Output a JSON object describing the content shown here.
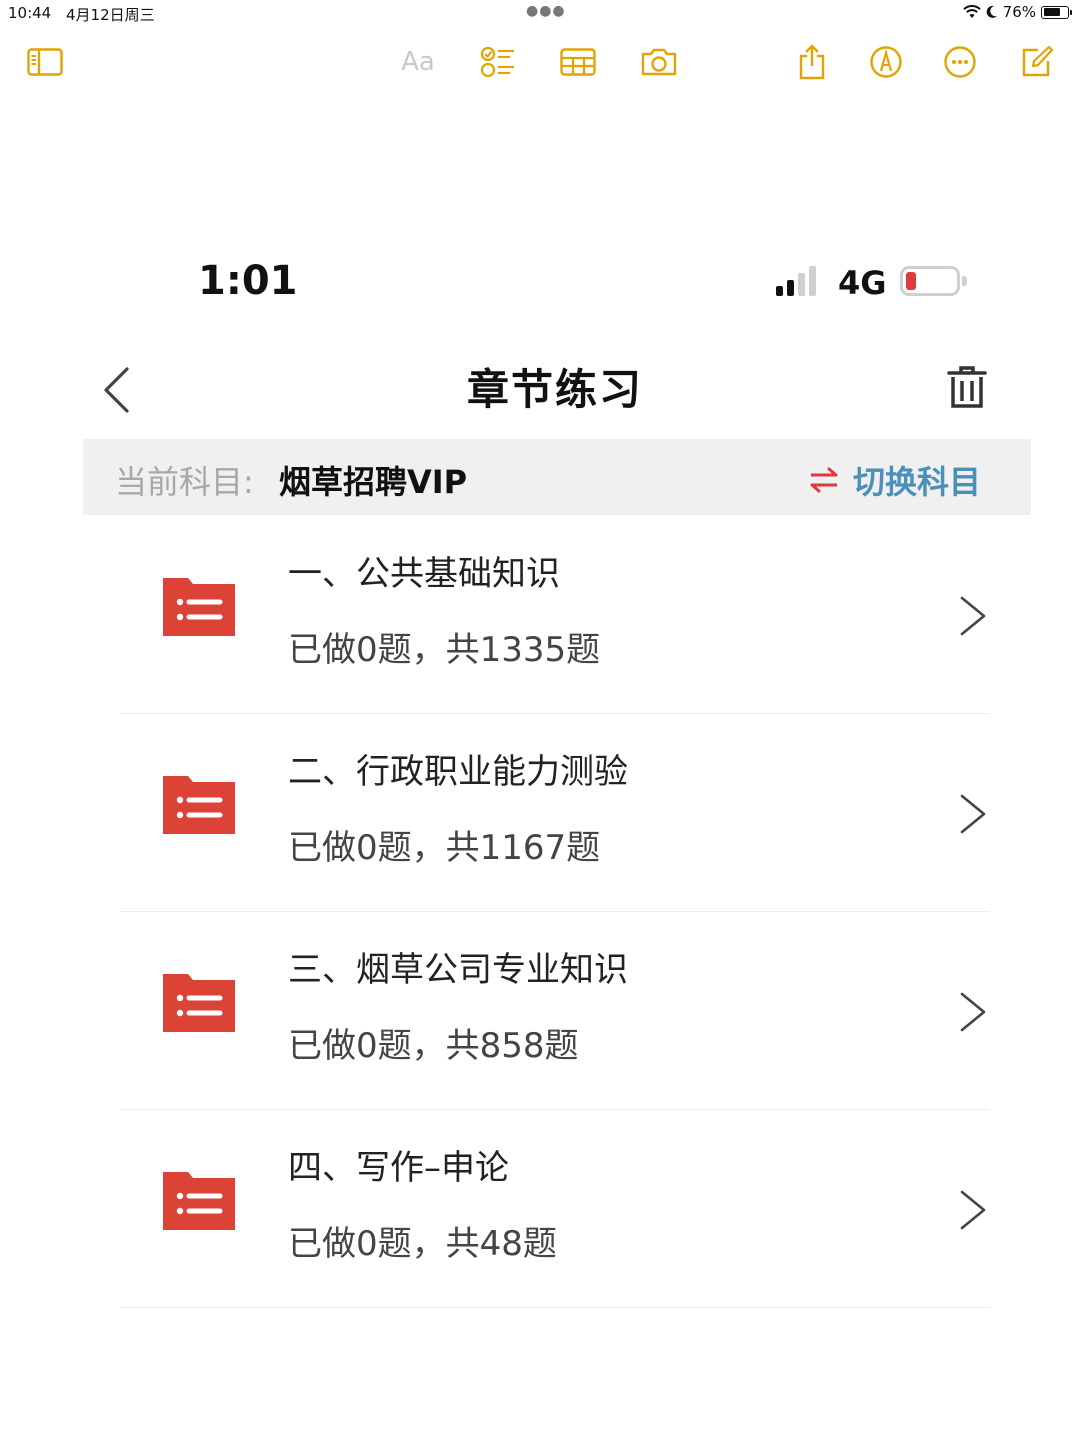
{
  "ipad_status": {
    "time": "10:44",
    "date": "4月12日周三",
    "battery_percent": "76%",
    "battery_level": 0.76
  },
  "toolbar": {
    "format_label": "Aa",
    "accent_color": "#e2a400",
    "icons": [
      "sidebar-icon",
      "format-icon",
      "checklist-icon",
      "table-icon",
      "camera-icon",
      "share-icon",
      "markup-icon",
      "more-icon",
      "compose-icon"
    ]
  },
  "phone_status": {
    "time": "1:01",
    "network": "4G",
    "battery_level": 0.2,
    "battery_color": "#e0393e"
  },
  "nav": {
    "title": "章节练习"
  },
  "subject": {
    "label": "当前科目:",
    "name": "烟草招聘VIP",
    "switch_label": "切换科目",
    "switch_color": "#4a90b8",
    "switch_icon_color": "#e0393e"
  },
  "chapters": [
    {
      "title": "一、公共基础知识",
      "progress": "已做0题，共1335题"
    },
    {
      "title": "二、行政职业能力测验",
      "progress": "已做0题，共1167题"
    },
    {
      "title": "三、烟草公司专业知识",
      "progress": "已做0题，共858题"
    },
    {
      "title": "四、写作–申论",
      "progress": "已做0题，共48题"
    }
  ],
  "folder_color": "#dd4236"
}
